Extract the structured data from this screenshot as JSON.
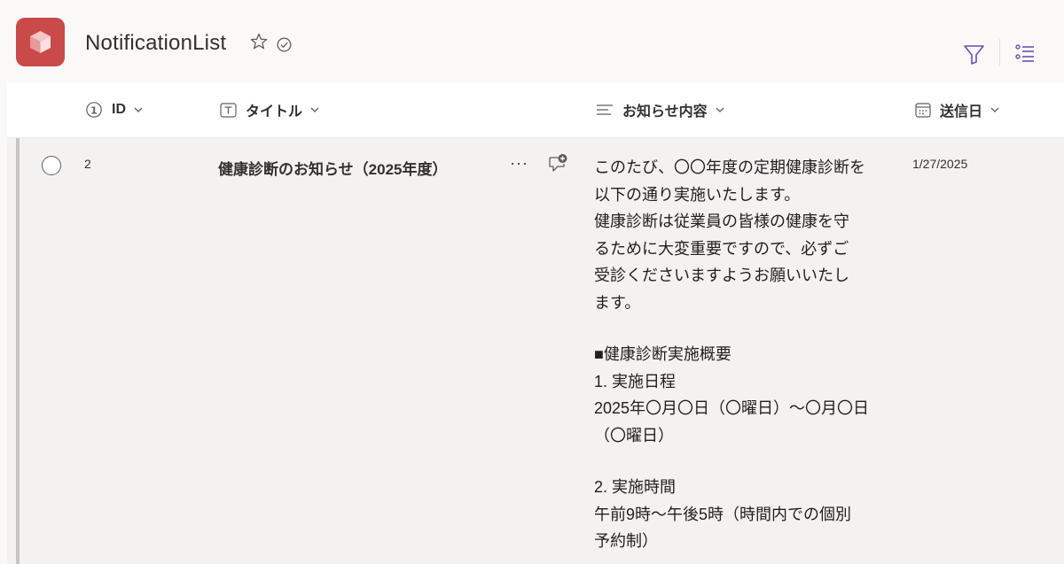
{
  "header": {
    "title": "NotificationList"
  },
  "columns": [
    {
      "label": "ID",
      "icon": "number-circle-icon"
    },
    {
      "label": "タイトル",
      "icon": "text-field-icon"
    },
    {
      "label": "お知らせ内容",
      "icon": "multiline-text-icon"
    },
    {
      "label": "送信日",
      "icon": "calendar-icon"
    }
  ],
  "rows": [
    {
      "id": "2",
      "title": "健康診断のお知らせ（2025年度）",
      "more_label": "···",
      "body": {
        "line1": "このたび、〇〇年度の定期健康診断を",
        "line2": "以下の通り実施いたします。",
        "line3": "健康診断は従業員の皆様の健康を守",
        "line4": "るために大変重要ですので、必ずご",
        "line5": "受診くださいますようお願いいたし",
        "line6": "ます。",
        "line7": "■健康診断実施概要",
        "line8": "1. 実施日程",
        "line9": "2025年〇月〇日（〇曜日）～〇月〇日",
        "line10": "（〇曜日）",
        "line11": "2. 実施時間",
        "line12": "午前9時～午後5時（時間内での個別",
        "line13": "予約制）"
      },
      "date": "1/27/2025"
    }
  ],
  "colors": {
    "app_icon": "#c94a49",
    "accent": "#6a4fb3",
    "row_bg": "#f3f2f1"
  }
}
